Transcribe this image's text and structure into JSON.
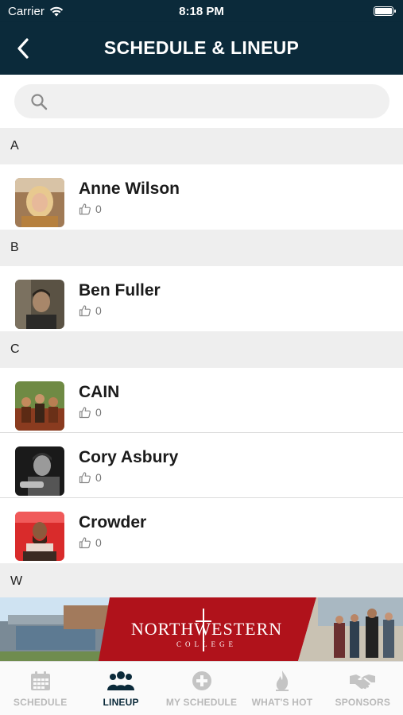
{
  "status_bar": {
    "carrier": "Carrier",
    "time": "8:18 PM"
  },
  "nav": {
    "title": "SCHEDULE & LINEUP"
  },
  "search": {
    "placeholder": ""
  },
  "sections": [
    {
      "letter": "A",
      "artists": [
        {
          "name": "Anne Wilson",
          "likes": "0"
        }
      ]
    },
    {
      "letter": "B",
      "artists": [
        {
          "name": "Ben Fuller",
          "likes": "0"
        }
      ]
    },
    {
      "letter": "C",
      "artists": [
        {
          "name": "CAIN",
          "likes": "0"
        },
        {
          "name": "Cory Asbury",
          "likes": "0"
        },
        {
          "name": "Crowder",
          "likes": "0"
        }
      ]
    },
    {
      "letter": "W",
      "artists": []
    }
  ],
  "banner": {
    "logo_text": "NORTHWESTERN",
    "logo_subtext": "COLLEGE",
    "brand_color": "#b0121b"
  },
  "tabs": [
    {
      "label": "SCHEDULE",
      "icon": "calendar-icon"
    },
    {
      "label": "LINEUP",
      "icon": "group-icon",
      "active": true
    },
    {
      "label": "MY SCHEDULE",
      "icon": "plus-circle-icon"
    },
    {
      "label": "WHAT'S HOT",
      "icon": "flame-icon"
    },
    {
      "label": "SPONSORS",
      "icon": "handshake-icon"
    }
  ],
  "colors": {
    "nav_bg": "#0b2a3a",
    "section_bg": "#eeeeee",
    "tab_active": "#0b2a3a",
    "tab_inactive": "#b9b9b9"
  }
}
